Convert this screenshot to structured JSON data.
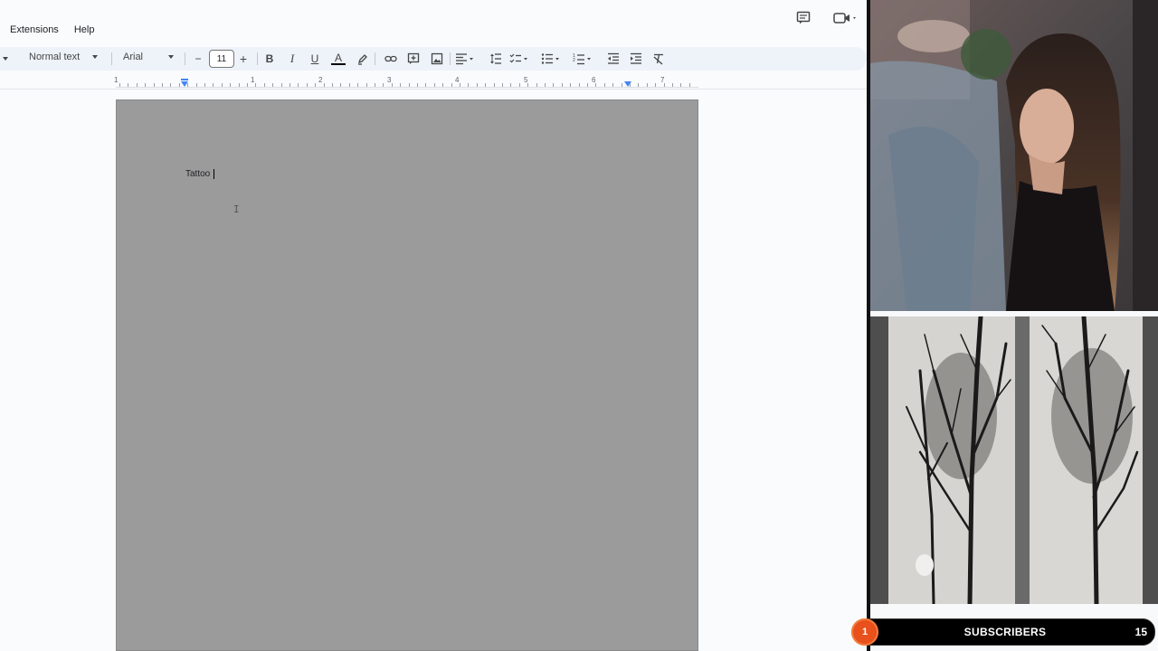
{
  "menubar": {
    "items": [
      "Extensions",
      "Help"
    ]
  },
  "toolbar": {
    "style_select": "Normal text",
    "font_select": "Arial",
    "font_size": "11",
    "decrease_label": "−",
    "increase_label": "+",
    "bold_label": "B",
    "italic_label": "I",
    "underline_label": "U",
    "text_color_label": "A"
  },
  "ruler": {
    "numbers": [
      "1",
      "1",
      "2",
      "3",
      "4",
      "5",
      "6",
      "7"
    ]
  },
  "document": {
    "text": "Tattoo "
  },
  "overlay": {
    "subscribers_badge": "1",
    "subscribers_label": "SUBSCRIBERS",
    "subscribers_count": "15"
  },
  "colors": {
    "page_bg": "#9b9b9b",
    "accent": "#4285f4",
    "badge": "#e8501c"
  }
}
